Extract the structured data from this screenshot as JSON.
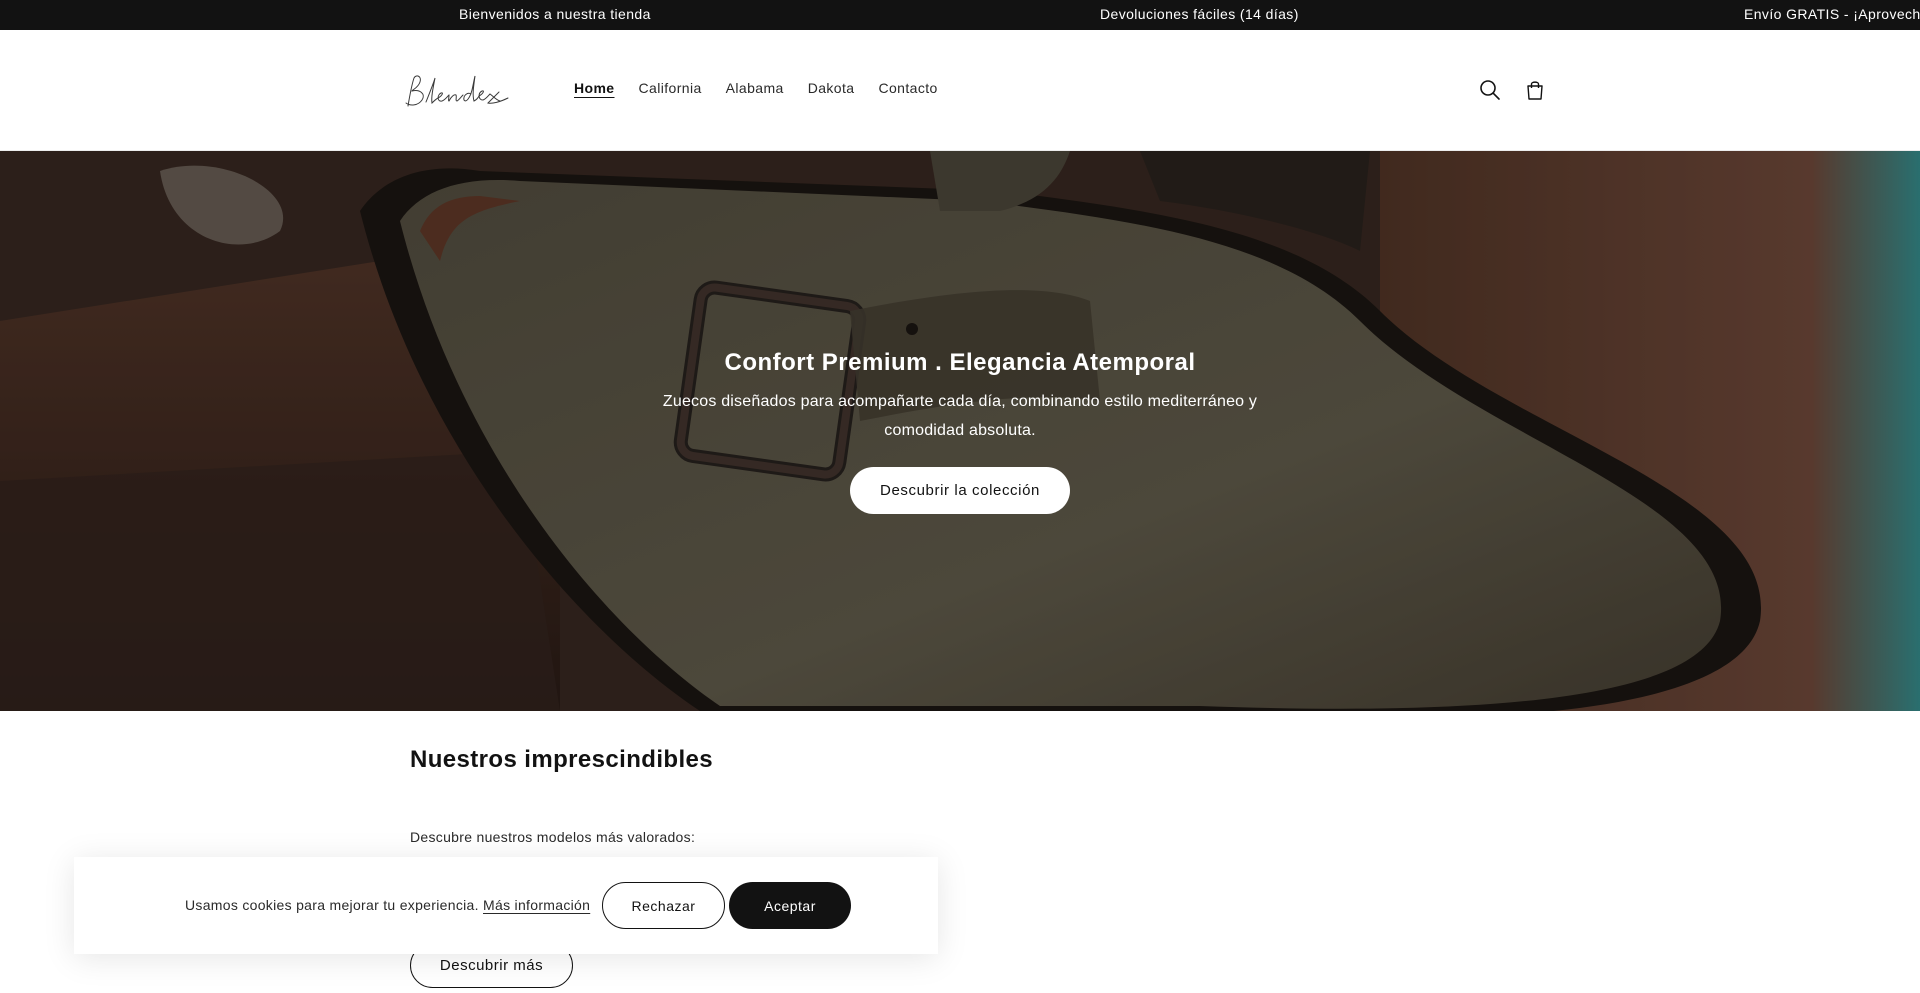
{
  "announcement": {
    "items": [
      "Bienvenidos a nuestra tienda",
      "Devoluciones fáciles (14 días)",
      "Envío GRATIS - ¡Aprovecha y"
    ]
  },
  "header": {
    "logo_text": "Blendex",
    "nav": [
      {
        "label": "Home",
        "active": true
      },
      {
        "label": "California"
      },
      {
        "label": "Alabama"
      },
      {
        "label": "Dakota"
      },
      {
        "label": "Contacto"
      }
    ],
    "icons": [
      "search-icon",
      "cart-icon"
    ]
  },
  "hero": {
    "title": "Confort Premium . Elegancia Atemporal",
    "subtitle": "Zuecos diseñados para acompañarte cada día, combinando estilo mediterráneo y comodidad absoluta.",
    "button_label": "Descubrir la colección"
  },
  "section": {
    "title": "Nuestros imprescindibles",
    "description": "Descubre nuestros modelos más valorados:",
    "button_label": "Descubrir más"
  },
  "cookie_banner": {
    "text": "Usamos cookies para mejorar tu experiencia.",
    "link_label": "Más información",
    "reject_label": "Rechazar",
    "accept_label": "Aceptar"
  }
}
